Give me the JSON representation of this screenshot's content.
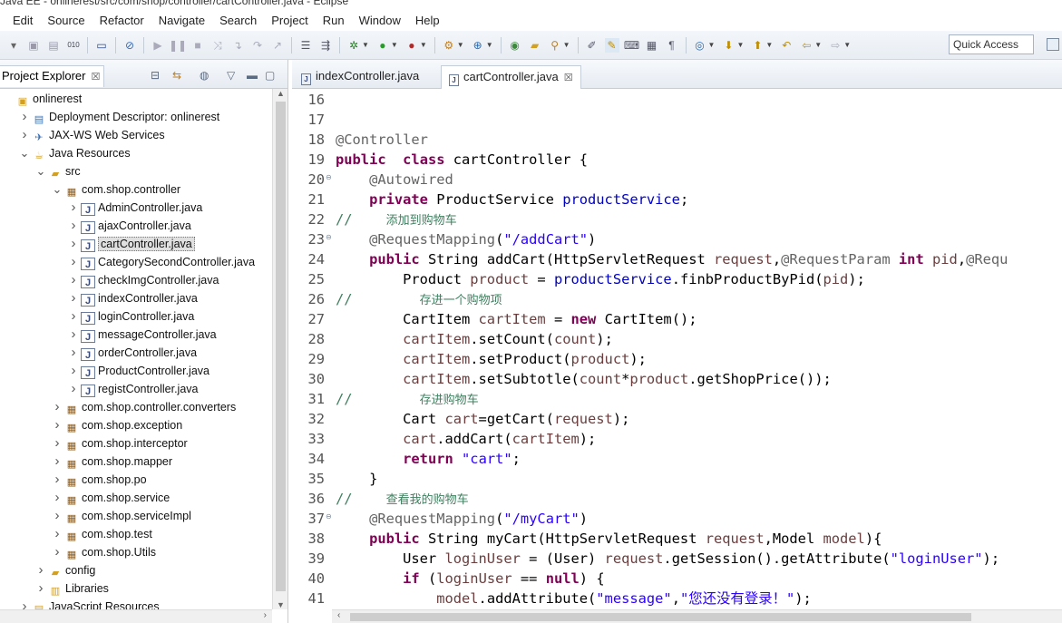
{
  "window": {
    "title": "Java EE - onlinerest/src/com/shop/controller/cartController.java - Eclipse"
  },
  "menu": [
    {
      "label": "Edit",
      "name": "menu-edit"
    },
    {
      "label": "Source",
      "name": "menu-source"
    },
    {
      "label": "Refactor",
      "name": "menu-refactor"
    },
    {
      "label": "Navigate",
      "name": "menu-navigate"
    },
    {
      "label": "Search",
      "name": "menu-search"
    },
    {
      "label": "Project",
      "name": "menu-project"
    },
    {
      "label": "Run",
      "name": "menu-run"
    },
    {
      "label": "Window",
      "name": "menu-window"
    },
    {
      "label": "Help",
      "name": "menu-help"
    }
  ],
  "toolbar": {
    "quick_access": "Quick Access"
  },
  "project_explorer": {
    "title": "Project Explorer",
    "close": "☒",
    "tree": [
      {
        "label": "onlinerest",
        "icon": "project-icon",
        "arrow": "",
        "indent": 0,
        "selected": false
      },
      {
        "label": "Deployment Descriptor: onlinerest",
        "icon": "deployment-descriptor-icon",
        "arrow": ">",
        "indent": 1,
        "selected": false
      },
      {
        "label": "JAX-WS Web Services",
        "icon": "web-services-icon",
        "arrow": ">",
        "indent": 1,
        "selected": false
      },
      {
        "label": "Java Resources",
        "icon": "java-resources-icon",
        "arrow": "v",
        "indent": 1,
        "selected": false
      },
      {
        "label": "src",
        "icon": "source-folder-icon",
        "arrow": "v",
        "indent": 2,
        "selected": false
      },
      {
        "label": "com.shop.controller",
        "icon": "package-icon",
        "arrow": "v",
        "indent": 3,
        "selected": false
      },
      {
        "label": "AdminController.java",
        "icon": "java-file-icon",
        "arrow": ">",
        "indent": 4,
        "selected": false
      },
      {
        "label": "ajaxController.java",
        "icon": "java-file-icon",
        "arrow": ">",
        "indent": 4,
        "selected": false
      },
      {
        "label": "cartController.java",
        "icon": "java-file-icon",
        "arrow": ">",
        "indent": 4,
        "selected": true
      },
      {
        "label": "CategorySecondController.java",
        "icon": "java-file-icon",
        "arrow": ">",
        "indent": 4,
        "selected": false
      },
      {
        "label": "checkImgController.java",
        "icon": "java-file-icon",
        "arrow": ">",
        "indent": 4,
        "selected": false
      },
      {
        "label": "indexController.java",
        "icon": "java-file-icon",
        "arrow": ">",
        "indent": 4,
        "selected": false
      },
      {
        "label": "loginController.java",
        "icon": "java-file-icon",
        "arrow": ">",
        "indent": 4,
        "selected": false
      },
      {
        "label": "messageController.java",
        "icon": "java-file-icon",
        "arrow": ">",
        "indent": 4,
        "selected": false
      },
      {
        "label": "orderController.java",
        "icon": "java-file-icon",
        "arrow": ">",
        "indent": 4,
        "selected": false
      },
      {
        "label": "ProductController.java",
        "icon": "java-file-icon",
        "arrow": ">",
        "indent": 4,
        "selected": false
      },
      {
        "label": "registController.java",
        "icon": "java-file-icon",
        "arrow": ">",
        "indent": 4,
        "selected": false
      },
      {
        "label": "com.shop.controller.converters",
        "icon": "package-icon",
        "arrow": ">",
        "indent": 3,
        "selected": false
      },
      {
        "label": "com.shop.exception",
        "icon": "package-icon",
        "arrow": ">",
        "indent": 3,
        "selected": false
      },
      {
        "label": "com.shop.interceptor",
        "icon": "package-icon",
        "arrow": ">",
        "indent": 3,
        "selected": false
      },
      {
        "label": "com.shop.mapper",
        "icon": "package-icon",
        "arrow": ">",
        "indent": 3,
        "selected": false
      },
      {
        "label": "com.shop.po",
        "icon": "package-icon",
        "arrow": ">",
        "indent": 3,
        "selected": false
      },
      {
        "label": "com.shop.service",
        "icon": "package-icon",
        "arrow": ">",
        "indent": 3,
        "selected": false
      },
      {
        "label": "com.shop.serviceImpl",
        "icon": "package-icon",
        "arrow": ">",
        "indent": 3,
        "selected": false
      },
      {
        "label": "com.shop.test",
        "icon": "package-icon",
        "arrow": ">",
        "indent": 3,
        "selected": false
      },
      {
        "label": "com.shop.Utils",
        "icon": "package-icon",
        "arrow": ">",
        "indent": 3,
        "selected": false
      },
      {
        "label": "config",
        "icon": "source-folder-icon",
        "arrow": ">",
        "indent": 2,
        "selected": false
      },
      {
        "label": "Libraries",
        "icon": "libraries-icon",
        "arrow": ">",
        "indent": 2,
        "selected": false
      },
      {
        "label": "JavaScript Resources",
        "icon": "javascript-resources-icon",
        "arrow": ">",
        "indent": 1,
        "selected": false
      }
    ]
  },
  "editor": {
    "tabs": [
      {
        "label": "indexController.java",
        "active": false
      },
      {
        "label": "cartController.java",
        "active": true,
        "close": "☒"
      }
    ],
    "lines": [
      {
        "n": "16",
        "fold": "",
        "tokens": []
      },
      {
        "n": "17",
        "fold": "",
        "tokens": []
      },
      {
        "n": "18",
        "fold": "",
        "tokens": [
          [
            "an",
            "@Controller"
          ]
        ]
      },
      {
        "n": "19",
        "fold": "",
        "tokens": [
          [
            "kw",
            "public"
          ],
          [
            "",
            "  "
          ],
          [
            "kw",
            "class"
          ],
          [
            "",
            " cartController {"
          ]
        ]
      },
      {
        "n": "20",
        "fold": "⊖",
        "tokens": [
          [
            "",
            "    "
          ],
          [
            "an",
            "@Autowired"
          ]
        ]
      },
      {
        "n": "21",
        "fold": "",
        "tokens": [
          [
            "",
            "    "
          ],
          [
            "kw",
            "private"
          ],
          [
            "",
            " ProductService "
          ],
          [
            "fld",
            "productService"
          ],
          [
            "",
            ";"
          ]
        ]
      },
      {
        "n": "22",
        "fold": "",
        "tokens": [
          [
            "cm",
            "//    "
          ],
          [
            "cm-cn",
            "添加到购物车"
          ]
        ]
      },
      {
        "n": "23",
        "fold": "⊖",
        "tokens": [
          [
            "",
            "    "
          ],
          [
            "an",
            "@RequestMapping"
          ],
          [
            "",
            "("
          ],
          [
            "str",
            "\"/addCart\""
          ],
          [
            "",
            ")"
          ]
        ]
      },
      {
        "n": "24",
        "fold": "",
        "tokens": [
          [
            "",
            "    "
          ],
          [
            "kw",
            "public"
          ],
          [
            "",
            " String addCart(HttpServletRequest "
          ],
          [
            "loc",
            "request"
          ],
          [
            "",
            ","
          ],
          [
            "an",
            "@RequestParam"
          ],
          [
            "",
            " "
          ],
          [
            "kw",
            "int"
          ],
          [
            "",
            " "
          ],
          [
            "loc",
            "pid"
          ],
          [
            "",
            ","
          ],
          [
            "an",
            "@Requ"
          ]
        ]
      },
      {
        "n": "25",
        "fold": "",
        "tokens": [
          [
            "",
            "        Product "
          ],
          [
            "loc",
            "product"
          ],
          [
            "",
            " = "
          ],
          [
            "fld",
            "productService"
          ],
          [
            "",
            ".finbProductByPid("
          ],
          [
            "loc",
            "pid"
          ],
          [
            "",
            ");"
          ]
        ]
      },
      {
        "n": "26",
        "fold": "",
        "tokens": [
          [
            "cm",
            "//        "
          ],
          [
            "cm-cn",
            "存进一个购物项"
          ]
        ]
      },
      {
        "n": "27",
        "fold": "",
        "tokens": [
          [
            "",
            "        CartItem "
          ],
          [
            "loc",
            "cartItem"
          ],
          [
            "",
            " = "
          ],
          [
            "kw",
            "new"
          ],
          [
            "",
            " CartItem();"
          ]
        ]
      },
      {
        "n": "28",
        "fold": "",
        "tokens": [
          [
            "",
            "        "
          ],
          [
            "loc",
            "cartItem"
          ],
          [
            "",
            ".setCount("
          ],
          [
            "loc",
            "count"
          ],
          [
            "",
            ");"
          ]
        ]
      },
      {
        "n": "29",
        "fold": "",
        "tokens": [
          [
            "",
            "        "
          ],
          [
            "loc",
            "cartItem"
          ],
          [
            "",
            ".setProduct("
          ],
          [
            "loc",
            "product"
          ],
          [
            "",
            ");"
          ]
        ]
      },
      {
        "n": "30",
        "fold": "",
        "tokens": [
          [
            "",
            "        "
          ],
          [
            "loc",
            "cartItem"
          ],
          [
            "",
            ".setSubtotle("
          ],
          [
            "loc",
            "count"
          ],
          [
            "",
            "*"
          ],
          [
            "loc",
            "product"
          ],
          [
            "",
            ".getShopPrice());"
          ]
        ]
      },
      {
        "n": "31",
        "fold": "",
        "tokens": [
          [
            "cm",
            "//        "
          ],
          [
            "cm-cn",
            "存进购物车"
          ]
        ]
      },
      {
        "n": "32",
        "fold": "",
        "tokens": [
          [
            "",
            "        Cart "
          ],
          [
            "loc",
            "cart"
          ],
          [
            "",
            "=getCart("
          ],
          [
            "loc",
            "request"
          ],
          [
            "",
            ");"
          ]
        ]
      },
      {
        "n": "33",
        "fold": "",
        "tokens": [
          [
            "",
            "        "
          ],
          [
            "loc",
            "cart"
          ],
          [
            "",
            ".addCart("
          ],
          [
            "loc",
            "cartItem"
          ],
          [
            "",
            ");"
          ]
        ]
      },
      {
        "n": "34",
        "fold": "",
        "tokens": [
          [
            "",
            "        "
          ],
          [
            "kw",
            "return"
          ],
          [
            "",
            " "
          ],
          [
            "str",
            "\"cart\""
          ],
          [
            "",
            ";"
          ]
        ]
      },
      {
        "n": "35",
        "fold": "",
        "tokens": [
          [
            "",
            "    }"
          ]
        ]
      },
      {
        "n": "36",
        "fold": "",
        "tokens": [
          [
            "cm",
            "//    "
          ],
          [
            "cm-cn",
            "查看我的购物车"
          ]
        ]
      },
      {
        "n": "37",
        "fold": "⊖",
        "tokens": [
          [
            "",
            "    "
          ],
          [
            "an",
            "@RequestMapping"
          ],
          [
            "",
            "("
          ],
          [
            "str",
            "\"/myCart\""
          ],
          [
            "",
            ")"
          ]
        ]
      },
      {
        "n": "38",
        "fold": "",
        "tokens": [
          [
            "",
            "    "
          ],
          [
            "kw",
            "public"
          ],
          [
            "",
            " String myCart(HttpServletRequest "
          ],
          [
            "loc",
            "request"
          ],
          [
            "",
            ",Model "
          ],
          [
            "loc",
            "model"
          ],
          [
            "",
            "){"
          ]
        ]
      },
      {
        "n": "39",
        "fold": "",
        "tokens": [
          [
            "",
            "        User "
          ],
          [
            "loc",
            "loginUser"
          ],
          [
            "",
            " = (User) "
          ],
          [
            "loc",
            "request"
          ],
          [
            "",
            ".getSession().getAttribute("
          ],
          [
            "str",
            "\"loginUser\""
          ],
          [
            "",
            ");"
          ]
        ]
      },
      {
        "n": "40",
        "fold": "",
        "tokens": [
          [
            "",
            "        "
          ],
          [
            "kw",
            "if"
          ],
          [
            "",
            " ("
          ],
          [
            "loc",
            "loginUser"
          ],
          [
            "",
            " == "
          ],
          [
            "kw",
            "null"
          ],
          [
            "",
            ") {"
          ]
        ]
      },
      {
        "n": "41",
        "fold": "",
        "tokens": [
          [
            "",
            "            "
          ],
          [
            "loc",
            "model"
          ],
          [
            "",
            ".addAttribute("
          ],
          [
            "str",
            "\"message\""
          ],
          [
            "",
            ","
          ],
          [
            "str",
            "\"您还没有登录！\""
          ],
          [
            "",
            ");"
          ]
        ]
      }
    ]
  }
}
